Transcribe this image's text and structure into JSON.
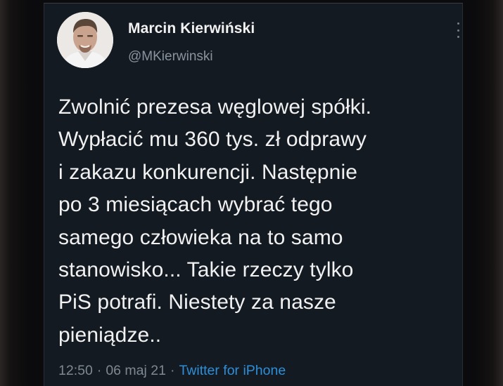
{
  "tweet": {
    "author_name": "Marcin Kierwiński",
    "author_handle": "@MKierwinski",
    "text": "Zwolnić prezesa węglowej spółki.\nWypłacić mu 360 tys. zł odprawy\ni zakazu konkurencji. Następnie\npo 3 miesiącach wybrać tego\nsamego człowieka na to samo\nstanowisko... Takie rzeczy tylko\nPiS potrafi. Niestety za nasze\npieniądze..",
    "time": "12:50",
    "separator": "·",
    "date": "06 maj 21",
    "source": "Twitter for iPhone"
  },
  "icons": {
    "avatar": "avatar-photo",
    "more": "more-vertical-icon"
  },
  "colors": {
    "background": "#141a22",
    "text": "#f1f1f1",
    "muted": "#7f8891",
    "link": "#2e8fd8"
  }
}
